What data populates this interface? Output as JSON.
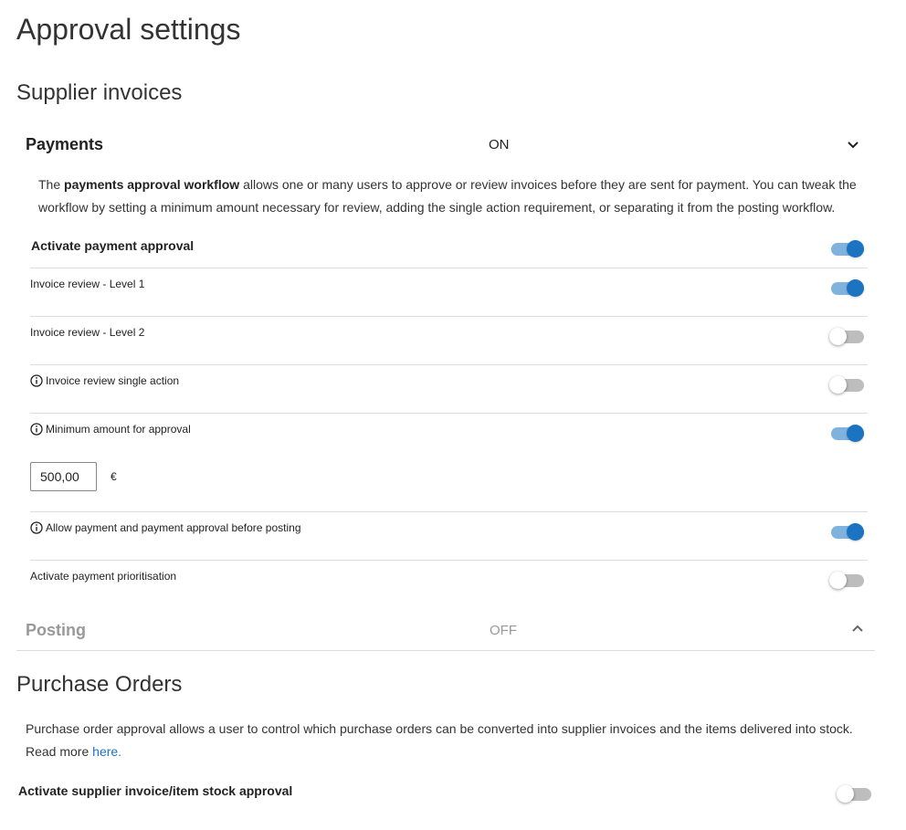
{
  "page": {
    "title": "Approval settings"
  },
  "supplier_invoices": {
    "title": "Supplier invoices",
    "payments": {
      "title": "Payments",
      "status": "ON",
      "description": {
        "prefix": "The ",
        "bold": "payments approval workflow",
        "line1_rest": " allows one or many users to approve or review invoices before they are sent for payment. You can tweak the",
        "line2": "workflow by setting a minimum amount necessary for review, adding the single action requirement, or separating it from the posting workflow."
      },
      "rows": [
        {
          "label": "Activate payment approval",
          "enabled": true
        },
        {
          "label": "Invoice review - Level 1",
          "enabled": true
        },
        {
          "label": "Invoice review - Level 2",
          "enabled": false
        },
        {
          "label": "Invoice review single action",
          "enabled": false,
          "info": true
        },
        {
          "label": "Minimum amount for approval",
          "enabled": true,
          "info": true
        },
        {
          "label": "Allow payment and payment approval before posting",
          "enabled": true,
          "info": true
        },
        {
          "label": "Activate payment prioritisation",
          "enabled": false
        }
      ],
      "minimum_amount": {
        "value": "500,00",
        "currency": "€"
      }
    },
    "posting": {
      "title": "Posting",
      "status": "OFF"
    }
  },
  "purchase_orders": {
    "title": "Purchase Orders",
    "description_line1": "Purchase order approval allows a user to control which purchase orders can be converted into supplier invoices and the items delivered into stock.",
    "read_more": "Read more ",
    "link_text": "here.",
    "row": {
      "label": "Activate supplier invoice/item stock approval",
      "enabled": false
    }
  }
}
